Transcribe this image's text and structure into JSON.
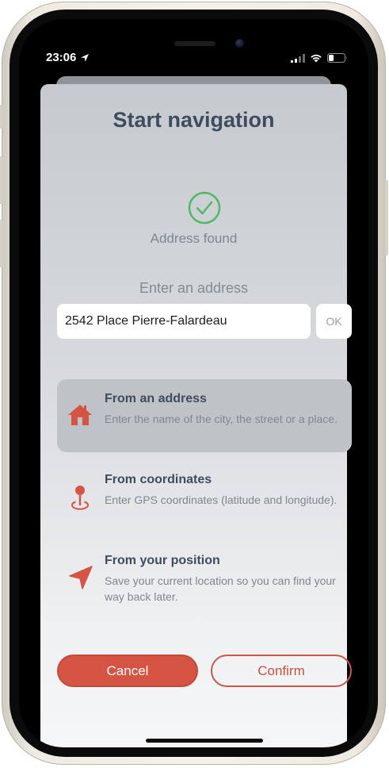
{
  "status_bar": {
    "time": "23:06"
  },
  "dialog": {
    "title": "Start navigation",
    "status_text": "Address found",
    "address_label": "Enter an address",
    "address_value": "2542 Place Pierre-Falardeau",
    "ok_label": "OK",
    "options": [
      {
        "title": "From an address",
        "description": "Enter the name of the city, the street or a place.",
        "icon": "home-icon",
        "selected": true
      },
      {
        "title": "From coordinates",
        "description": "Enter GPS coordinates (latitude and longitude).",
        "icon": "map-pin-icon",
        "selected": false
      },
      {
        "title": "From your position",
        "description": "Save your current location so you can find your way back later.",
        "icon": "navigation-arrow-icon",
        "selected": false
      }
    ],
    "cancel_label": "Cancel",
    "confirm_label": "Confirm"
  },
  "colors": {
    "accent": "#d65443",
    "success": "#4cb963",
    "title": "#3f4c5e"
  }
}
